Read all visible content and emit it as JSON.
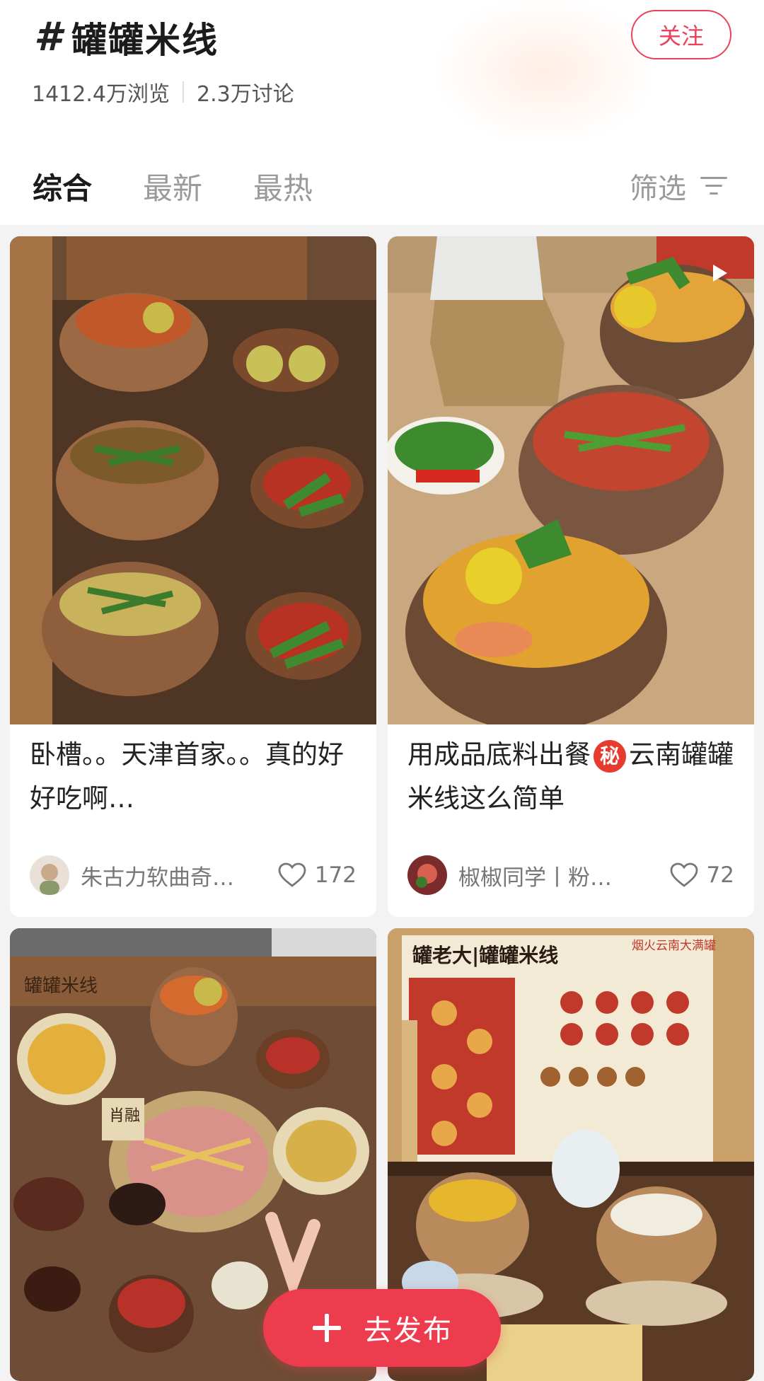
{
  "topic": {
    "hash": "#",
    "name": "罐罐米线",
    "follow_label": "关注",
    "views": "1412.4万浏览",
    "discussions": "2.3万讨论"
  },
  "tabs": [
    {
      "label": "综合",
      "active": true
    },
    {
      "label": "最新",
      "active": false
    },
    {
      "label": "最热",
      "active": false
    }
  ],
  "filter_label": "筛选",
  "posts": [
    {
      "title": "卧槽。。天津首家。。真的好好吃啊…",
      "author": "朱古力软曲奇…",
      "likes": "172",
      "is_video": false
    },
    {
      "title_part1": "用成品底料出餐",
      "secret_badge": "秘",
      "title_part2": "云南罐罐米线这么简单",
      "author": "椒椒同学丨粉…",
      "likes": "72",
      "is_video": true
    },
    {
      "signboard_text": "肖融"
    },
    {
      "menu_title": "罐老大|罐罐米线",
      "menu_tag": "烟火云南大满罐"
    }
  ],
  "publish_label": "去发布",
  "colors": {
    "accent": "#ee3c4f",
    "follow_border": "#e8435a",
    "secret_badge": "#e63b2e"
  }
}
